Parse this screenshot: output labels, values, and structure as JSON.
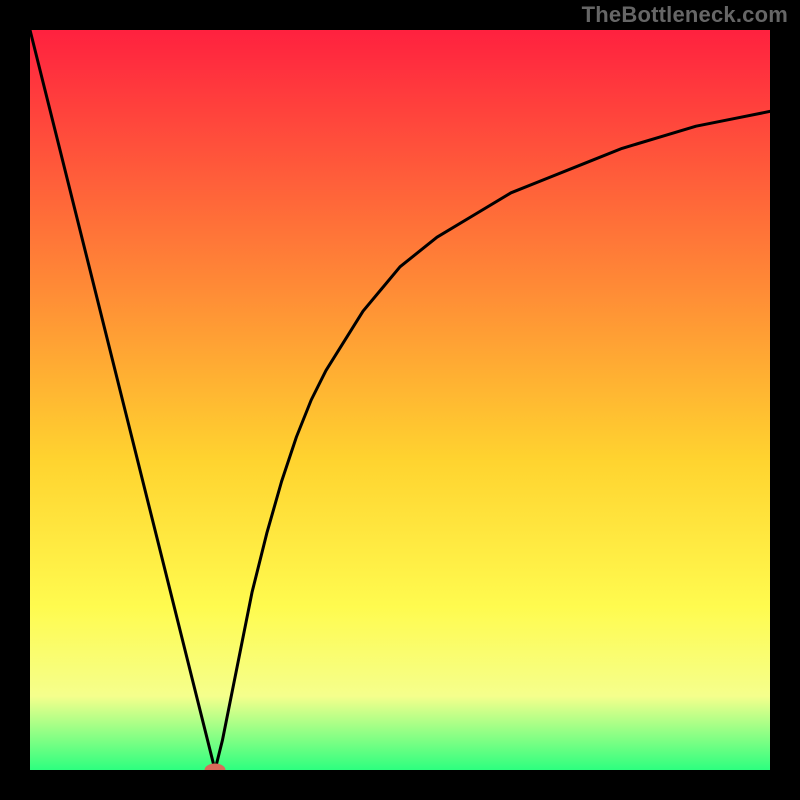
{
  "watermark": "TheBottleneck.com",
  "colors": {
    "frame": "#000000",
    "watermark": "#666666",
    "gradient_top": "#ff213f",
    "gradient_mid1": "#ff8b36",
    "gradient_mid2": "#ffd32f",
    "gradient_mid3": "#fffb4f",
    "gradient_mid4": "#f5ff8c",
    "gradient_bottom": "#2dff7f",
    "curve": "#000000",
    "marker_fill": "#d86a5a",
    "marker_stroke": "#d86a5a"
  },
  "chart_data": {
    "type": "line",
    "title": "",
    "xlabel": "",
    "ylabel": "",
    "xlim": [
      0,
      100
    ],
    "ylim": [
      0,
      100
    ],
    "grid": false,
    "legend": false,
    "series": [
      {
        "name": "bottleneck-curve",
        "x": [
          0,
          2,
          4,
          6,
          8,
          10,
          12,
          14,
          16,
          18,
          20,
          22,
          24,
          25,
          26,
          28,
          30,
          32,
          34,
          36,
          38,
          40,
          45,
          50,
          55,
          60,
          65,
          70,
          75,
          80,
          85,
          90,
          95,
          100
        ],
        "y": [
          100,
          92,
          84,
          76,
          68,
          60,
          52,
          44,
          36,
          28,
          20,
          12,
          4,
          0,
          4,
          14,
          24,
          32,
          39,
          45,
          50,
          54,
          62,
          68,
          72,
          75,
          78,
          80,
          82,
          84,
          85.5,
          87,
          88,
          89
        ]
      }
    ],
    "annotations": [
      {
        "name": "min-marker",
        "x": 25,
        "y": 0,
        "shape": "ellipse"
      }
    ]
  }
}
